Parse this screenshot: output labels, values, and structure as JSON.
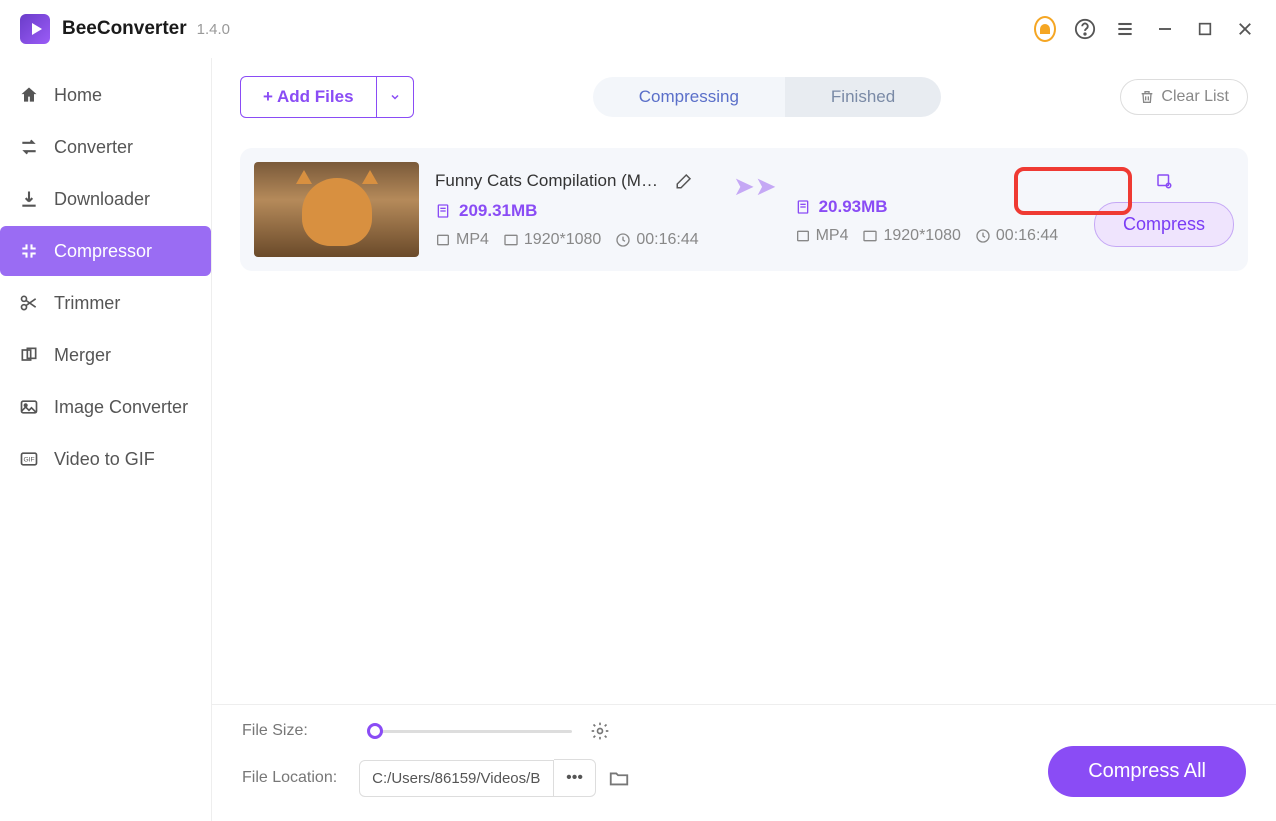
{
  "app": {
    "name": "BeeConverter",
    "version": "1.4.0"
  },
  "sidebar": {
    "items": [
      {
        "label": "Home",
        "icon": "home-icon"
      },
      {
        "label": "Converter",
        "icon": "converter-icon"
      },
      {
        "label": "Downloader",
        "icon": "downloader-icon"
      },
      {
        "label": "Compressor",
        "icon": "compressor-icon"
      },
      {
        "label": "Trimmer",
        "icon": "trimmer-icon"
      },
      {
        "label": "Merger",
        "icon": "merger-icon"
      },
      {
        "label": "Image Converter",
        "icon": "image-converter-icon"
      },
      {
        "label": "Video to GIF",
        "icon": "video-gif-icon"
      }
    ],
    "active_index": 3
  },
  "toolbar": {
    "add_files": "+ Add Files",
    "tabs": [
      "Compressing",
      "Finished"
    ],
    "active_tab": 0,
    "clear_list": "Clear List"
  },
  "file": {
    "title": "Funny Cats Compilation (Mos...",
    "input": {
      "size": "209.31MB",
      "format": "MP4",
      "resolution": "1920*1080",
      "duration": "00:16:44"
    },
    "output": {
      "size": "20.93MB",
      "format": "MP4",
      "resolution": "1920*1080",
      "duration": "00:16:44"
    },
    "compress_label": "Compress"
  },
  "footer": {
    "file_size_label": "File Size:",
    "file_location_label": "File Location:",
    "file_location_path": "C:/Users/86159/Videos/B",
    "compress_all": "Compress All"
  }
}
